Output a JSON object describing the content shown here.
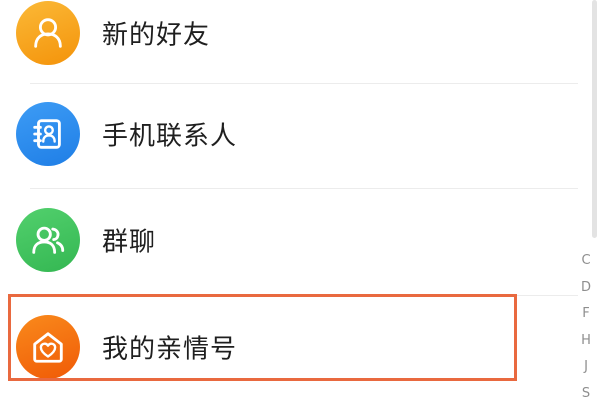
{
  "items": [
    {
      "label": "新的好友",
      "icon": "person-icon",
      "color": "#f8a51d"
    },
    {
      "label": "手机联系人",
      "icon": "contact-book-icon",
      "color": "#2f8ff0"
    },
    {
      "label": "群聊",
      "icon": "group-icon",
      "color": "#41c55f"
    },
    {
      "label": "我的亲情号",
      "icon": "family-home-icon",
      "color": "#f5680a"
    }
  ],
  "index_letters": [
    "C",
    "D",
    "F",
    "H",
    "J",
    "S"
  ],
  "highlight_color": "#e9693f"
}
